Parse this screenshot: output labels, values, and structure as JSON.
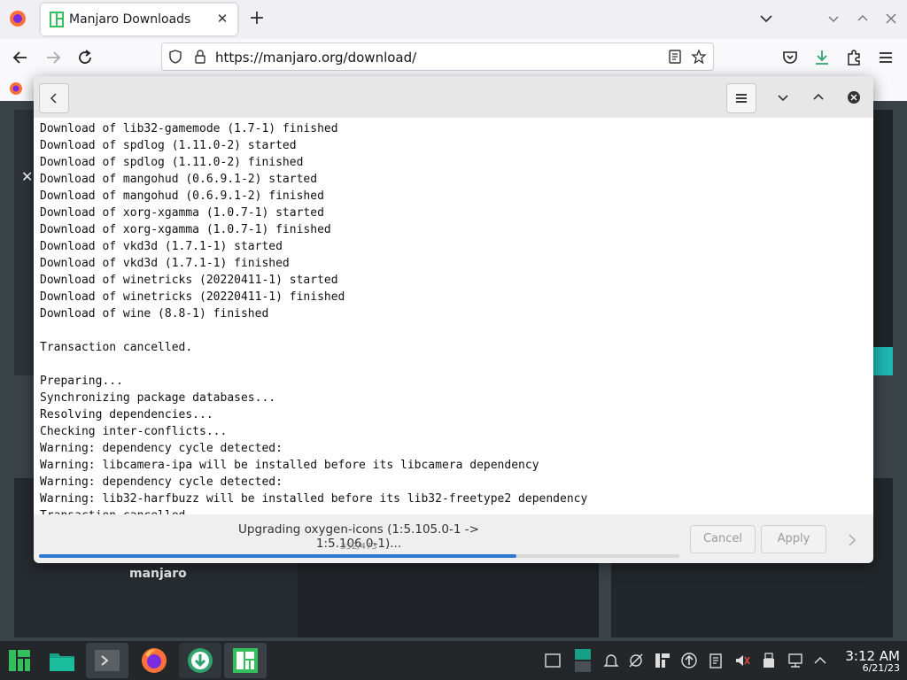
{
  "browser": {
    "tab_title": "Manjaro Downloads",
    "url": "https://manjaro.org/download/"
  },
  "page": {
    "brand": "manjaro"
  },
  "dialog": {
    "log": "Download of lib32-gamemode (1.7-1) finished\nDownload of spdlog (1.11.0-2) started\nDownload of spdlog (1.11.0-2) finished\nDownload of mangohud (0.6.9.1-2) started\nDownload of mangohud (0.6.9.1-2) finished\nDownload of xorg-xgamma (1.0.7-1) started\nDownload of xorg-xgamma (1.0.7-1) finished\nDownload of vkd3d (1.7.1-1) started\nDownload of vkd3d (1.7.1-1) finished\nDownload of winetricks (20220411-1) started\nDownload of winetricks (20220411-1) finished\nDownload of wine (8.8-1) finished\n\nTransaction cancelled.\n\nPreparing...\nSynchronizing package databases...\nResolving dependencies...\nChecking inter-conflicts...\nWarning: dependency cycle detected:\nWarning: libcamera-ipa will be installed before its libcamera dependency\nWarning: dependency cycle detected:\nWarning: lib32-harfbuzz will be installed before its lib32-freetype2 dependency\nTransaction cancelled.",
    "status": "Upgrading oxygen-icons (1:5.105.0-1 -> 1:5.106.0-1)...",
    "counter": "352/473",
    "progress": 0.745,
    "cancel_label": "Cancel",
    "apply_label": "Apply"
  },
  "taskbar": {
    "time": "3:12 AM",
    "date": "6/21/23"
  },
  "colors": {
    "accent": "#2a7ad3",
    "manjaro_green": "#35bf5c",
    "manjaro_teal": "#1fb5b0"
  }
}
